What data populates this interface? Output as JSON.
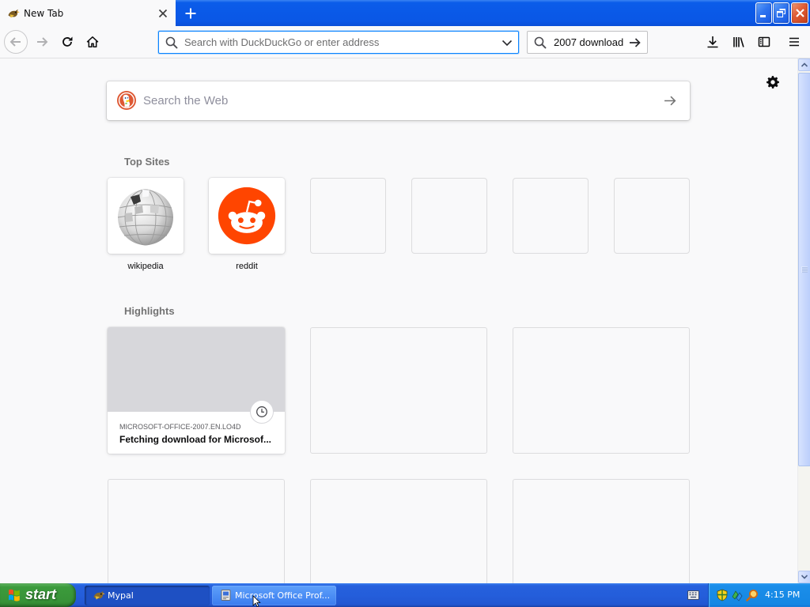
{
  "browser": {
    "tab": {
      "title": "New Tab",
      "icon": "mypal-icon"
    },
    "window_controls": [
      "minimize-icon",
      "restore-icon",
      "close-icon"
    ]
  },
  "toolbar": {
    "address_placeholder": "Search with DuckDuckGo or enter address",
    "search_value": "2007 download",
    "icons": [
      "back-icon",
      "forward-icon",
      "reload-icon",
      "home-icon",
      "search-icon",
      "chevron-down-icon",
      "arrow-right-icon",
      "download-icon",
      "library-icon",
      "sidebar-icon",
      "menu-icon"
    ]
  },
  "newtab": {
    "search_placeholder": "Search the Web",
    "search_icon": "duckduckgo-icon",
    "settings_icon": "gear-icon",
    "top_sites_heading": "Top Sites",
    "top_sites": [
      {
        "label": "wikipedia",
        "icon": "wikipedia-globe-icon"
      },
      {
        "label": "reddit",
        "icon": "reddit-icon"
      }
    ],
    "highlights_heading": "Highlights",
    "highlights": [
      {
        "source": "MICROSOFT-OFFICE-2007.EN.LO4D",
        "title": "Fetching download for Microsof...",
        "icon": "clock-icon"
      }
    ]
  },
  "taskbar": {
    "start_label": "start",
    "buttons": [
      {
        "label": "Mypal",
        "icon": "mypal-icon"
      },
      {
        "label": "Microsoft Office Prof...",
        "icon": "installer-icon"
      }
    ],
    "tray_icons": [
      "keyboard-icon",
      "security-shield-icon",
      "network-icon",
      "search-agent-icon"
    ],
    "clock": "4:15 PM"
  },
  "colors": {
    "accent_blue": "#0a84ff",
    "titlebar_blue": "#0a57e6",
    "close_red": "#df5b34",
    "start_green": "#3c9b3c",
    "taskbar_blue": "#245edb",
    "tray_blue": "#1587e4",
    "highlight_placeholder": "#d7d7db",
    "ddg_orange": "#de5833",
    "reddit_orange": "#ff4500"
  }
}
